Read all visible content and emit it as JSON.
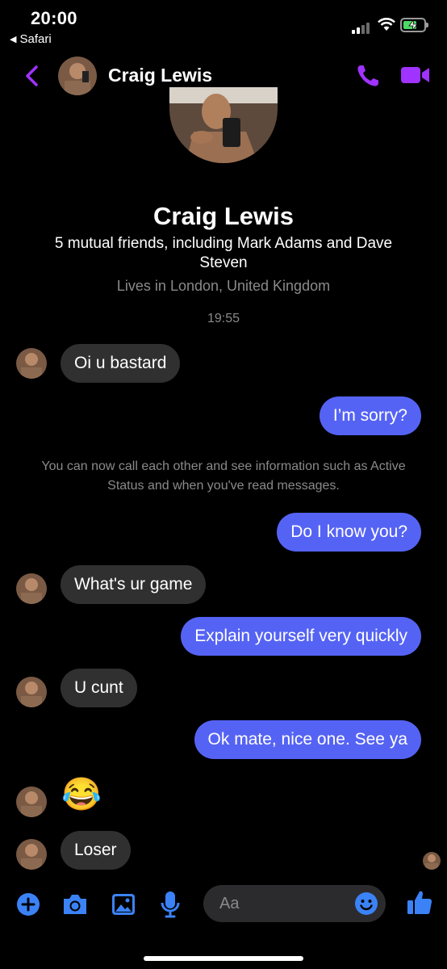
{
  "status_bar": {
    "time": "20:00",
    "back_app": "Safari"
  },
  "header": {
    "contact_name": "Craig Lewis"
  },
  "profile": {
    "name": "Craig Lewis",
    "mutual": "5 mutual friends, including Mark Adams and Dave Steven",
    "lives": "Lives in London, United Kingdom"
  },
  "timestamp": "19:55",
  "messages": [
    {
      "from": "them",
      "text": "Oi u bastard"
    },
    {
      "from": "me",
      "text": "I’m sorry?"
    },
    {
      "from": "me",
      "text": "Do I know you?"
    },
    {
      "from": "them",
      "text": "What's ur game"
    },
    {
      "from": "me",
      "text": "Explain yourself very quickly"
    },
    {
      "from": "them",
      "text": "U cunt"
    },
    {
      "from": "me",
      "text": "Ok mate, nice one. See ya"
    },
    {
      "from": "them",
      "text": "😂"
    },
    {
      "from": "them",
      "text": "Loser"
    }
  ],
  "system_message": "You can now call each other and see information such as Active Status and when you've read messages.",
  "composer": {
    "placeholder": "Aa"
  },
  "colors": {
    "accent": "#a033ff",
    "bubble_out": "#5563f4",
    "bubble_in": "#303030",
    "icon_blue": "#3b82f6"
  }
}
